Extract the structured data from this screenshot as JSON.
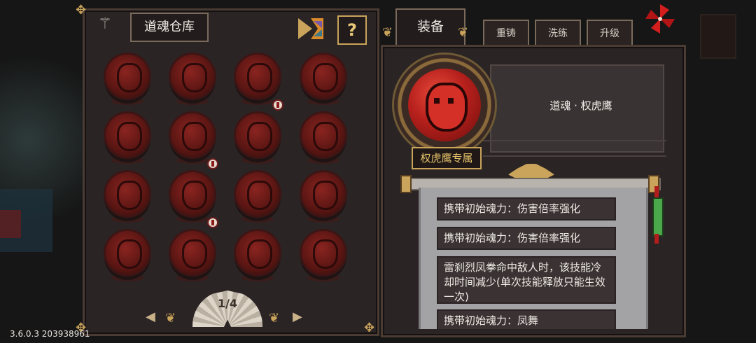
{
  "warehouse": {
    "title": "道魂仓库",
    "help_label": "?",
    "pager": "1/4",
    "prev_arrow": "◀",
    "next_arrow": "▶",
    "souls": [
      {
        "name": "soul-1",
        "badge": false
      },
      {
        "name": "soul-2",
        "badge": false
      },
      {
        "name": "soul-3",
        "badge": true
      },
      {
        "name": "soul-4",
        "badge": false
      },
      {
        "name": "soul-5",
        "badge": false
      },
      {
        "name": "soul-6",
        "badge": true
      },
      {
        "name": "soul-7",
        "badge": false
      },
      {
        "name": "soul-8",
        "badge": false
      },
      {
        "name": "soul-9",
        "badge": false
      },
      {
        "name": "soul-10",
        "badge": true
      },
      {
        "name": "soul-11",
        "badge": false
      },
      {
        "name": "soul-12",
        "badge": false
      },
      {
        "name": "soul-13",
        "badge": false
      },
      {
        "name": "soul-14",
        "badge": false
      },
      {
        "name": "soul-15",
        "badge": false
      },
      {
        "name": "soul-16",
        "badge": false
      }
    ]
  },
  "tabs": {
    "equip": "装备",
    "recast": "重铸",
    "wash": "洗练",
    "upgrade": "升级"
  },
  "detail": {
    "soul_name": "道魂 · 权虎鹰",
    "exclusive_label": "权虎鹰专属",
    "effects": [
      "携带初始魂力：伤害倍率强化",
      "携带初始魂力：伤害倍率强化",
      "雷刹烈凤拳命中敌人时，该技能冷却时间减少(单次技能释放只能生效一次)",
      "携带初始魂力：凤舞"
    ]
  },
  "version": "3.6.0.3 203938961",
  "colors": {
    "accent_gold": "#c9a45a",
    "soul_red": "#8a2420",
    "panel": "#2b2425"
  },
  "icons": [
    "trident-icon",
    "shop-icon",
    "help-icon",
    "pinwheel-icon",
    "fan-icon",
    "badge-icon"
  ]
}
